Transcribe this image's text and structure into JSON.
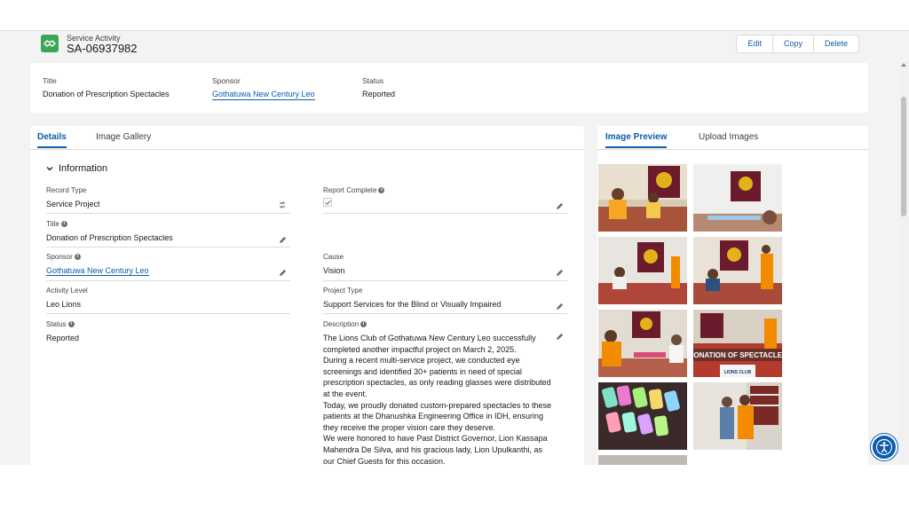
{
  "header": {
    "object_type": "Service Activity",
    "record_name": "SA-06937982",
    "buttons": {
      "edit": "Edit",
      "copy": "Copy",
      "delete": "Delete"
    }
  },
  "highlights": {
    "title_label": "Title",
    "title_value": "Donation of Prescription Spectacles",
    "sponsor_label": "Sponsor",
    "sponsor_value": "Gothatuwa New Century Leo",
    "status_label": "Status",
    "status_value": "Reported"
  },
  "left_tabs": {
    "details": "Details",
    "gallery": "Image Gallery"
  },
  "section": {
    "information": "Information"
  },
  "fields": {
    "record_type_label": "Record Type",
    "record_type_value": "Service Project",
    "report_complete_label": "Report Complete",
    "report_complete_checked": true,
    "title_label": "Title",
    "title_value": "Donation of Prescription Spectacles",
    "sponsor_label": "Sponsor",
    "sponsor_value": "Gothatuwa New Century Leo",
    "cause_label": "Cause",
    "cause_value": "Vision",
    "activity_level_label": "Activity Level",
    "activity_level_value": "Leo Lions",
    "project_type_label": "Project Type",
    "project_type_value": "Support Services for the Blind or Visually Impaired",
    "status_label": "Status",
    "status_value": "Reported",
    "description_label": "Description",
    "description_lines": [
      "The Lions Club of Gothatuwa New Century Leo successfully",
      "completed another impactful project on March 2, 2025.",
      "During a recent multi-service project, we conducted eye",
      "screenings and identified 30+ patients in need of special",
      "prescription spectacles, as only reading glasses were distributed",
      "at the event.",
      "Today, we proudly donated custom-prepared spectacles to these",
      "patients at the Dhanushka Engineering Office in IDH, ensuring",
      "they receive the proper vision care they deserve.",
      "We were honored to have Past District Governor, Lion Kassapa",
      "Mahendra De Silva, and his gracious lady, Lion Upulkanthi, as",
      "our Chief Guests for this occasion."
    ]
  },
  "right_tabs": {
    "preview": "Image Preview",
    "upload": "Upload Images"
  },
  "gallery": {
    "photo_caption": "DONATION OF SPECTACLES",
    "banner_text": "LIONS CLUB"
  },
  "colors": {
    "brand_blue": "#0b5cab",
    "object_green": "#3ba755",
    "leo_orange": "#f28b00"
  }
}
